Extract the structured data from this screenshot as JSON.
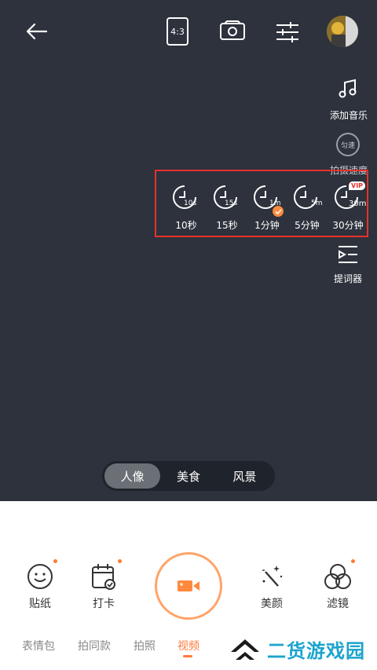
{
  "topbar": {
    "back_icon": "arrow-left-icon",
    "ratio_label": "4:3",
    "switch_icon": "camera-switch-icon",
    "settings_icon": "sliders-icon",
    "avatar_icon": "avatar"
  },
  "side": {
    "music_label": "添加音乐",
    "speed_badge": "匀速",
    "speed_label": "拍摄速度",
    "prompter_label": "提词器"
  },
  "timers": [
    {
      "sub": "10s",
      "label": "10秒",
      "selected": false,
      "vip": false
    },
    {
      "sub": "15s",
      "label": "15秒",
      "selected": false,
      "vip": false
    },
    {
      "sub": "1m",
      "label": "1分钟",
      "selected": true,
      "vip": false
    },
    {
      "sub": "5m",
      "label": "5分钟",
      "selected": false,
      "vip": false
    },
    {
      "sub": "30m",
      "label": "30分钟",
      "selected": false,
      "vip": true
    }
  ],
  "vip_badge": "VIP",
  "modes": [
    {
      "label": "人像",
      "active": true
    },
    {
      "label": "美食",
      "active": false
    },
    {
      "label": "风景",
      "active": false
    }
  ],
  "tools": {
    "sticker": "贴纸",
    "checkin": "打卡",
    "beauty": "美颜",
    "filter": "滤镜"
  },
  "tabs": [
    {
      "label": "表情包",
      "active": false
    },
    {
      "label": "拍同款",
      "active": false
    },
    {
      "label": "拍照",
      "active": false
    },
    {
      "label": "视频",
      "active": true
    }
  ],
  "watermark": "二货游戏园",
  "colors": {
    "accent": "#ff7a3a",
    "camera_bg": "#2d323c",
    "highlight": "#e8312c",
    "watermark": "#1ba4ce"
  }
}
